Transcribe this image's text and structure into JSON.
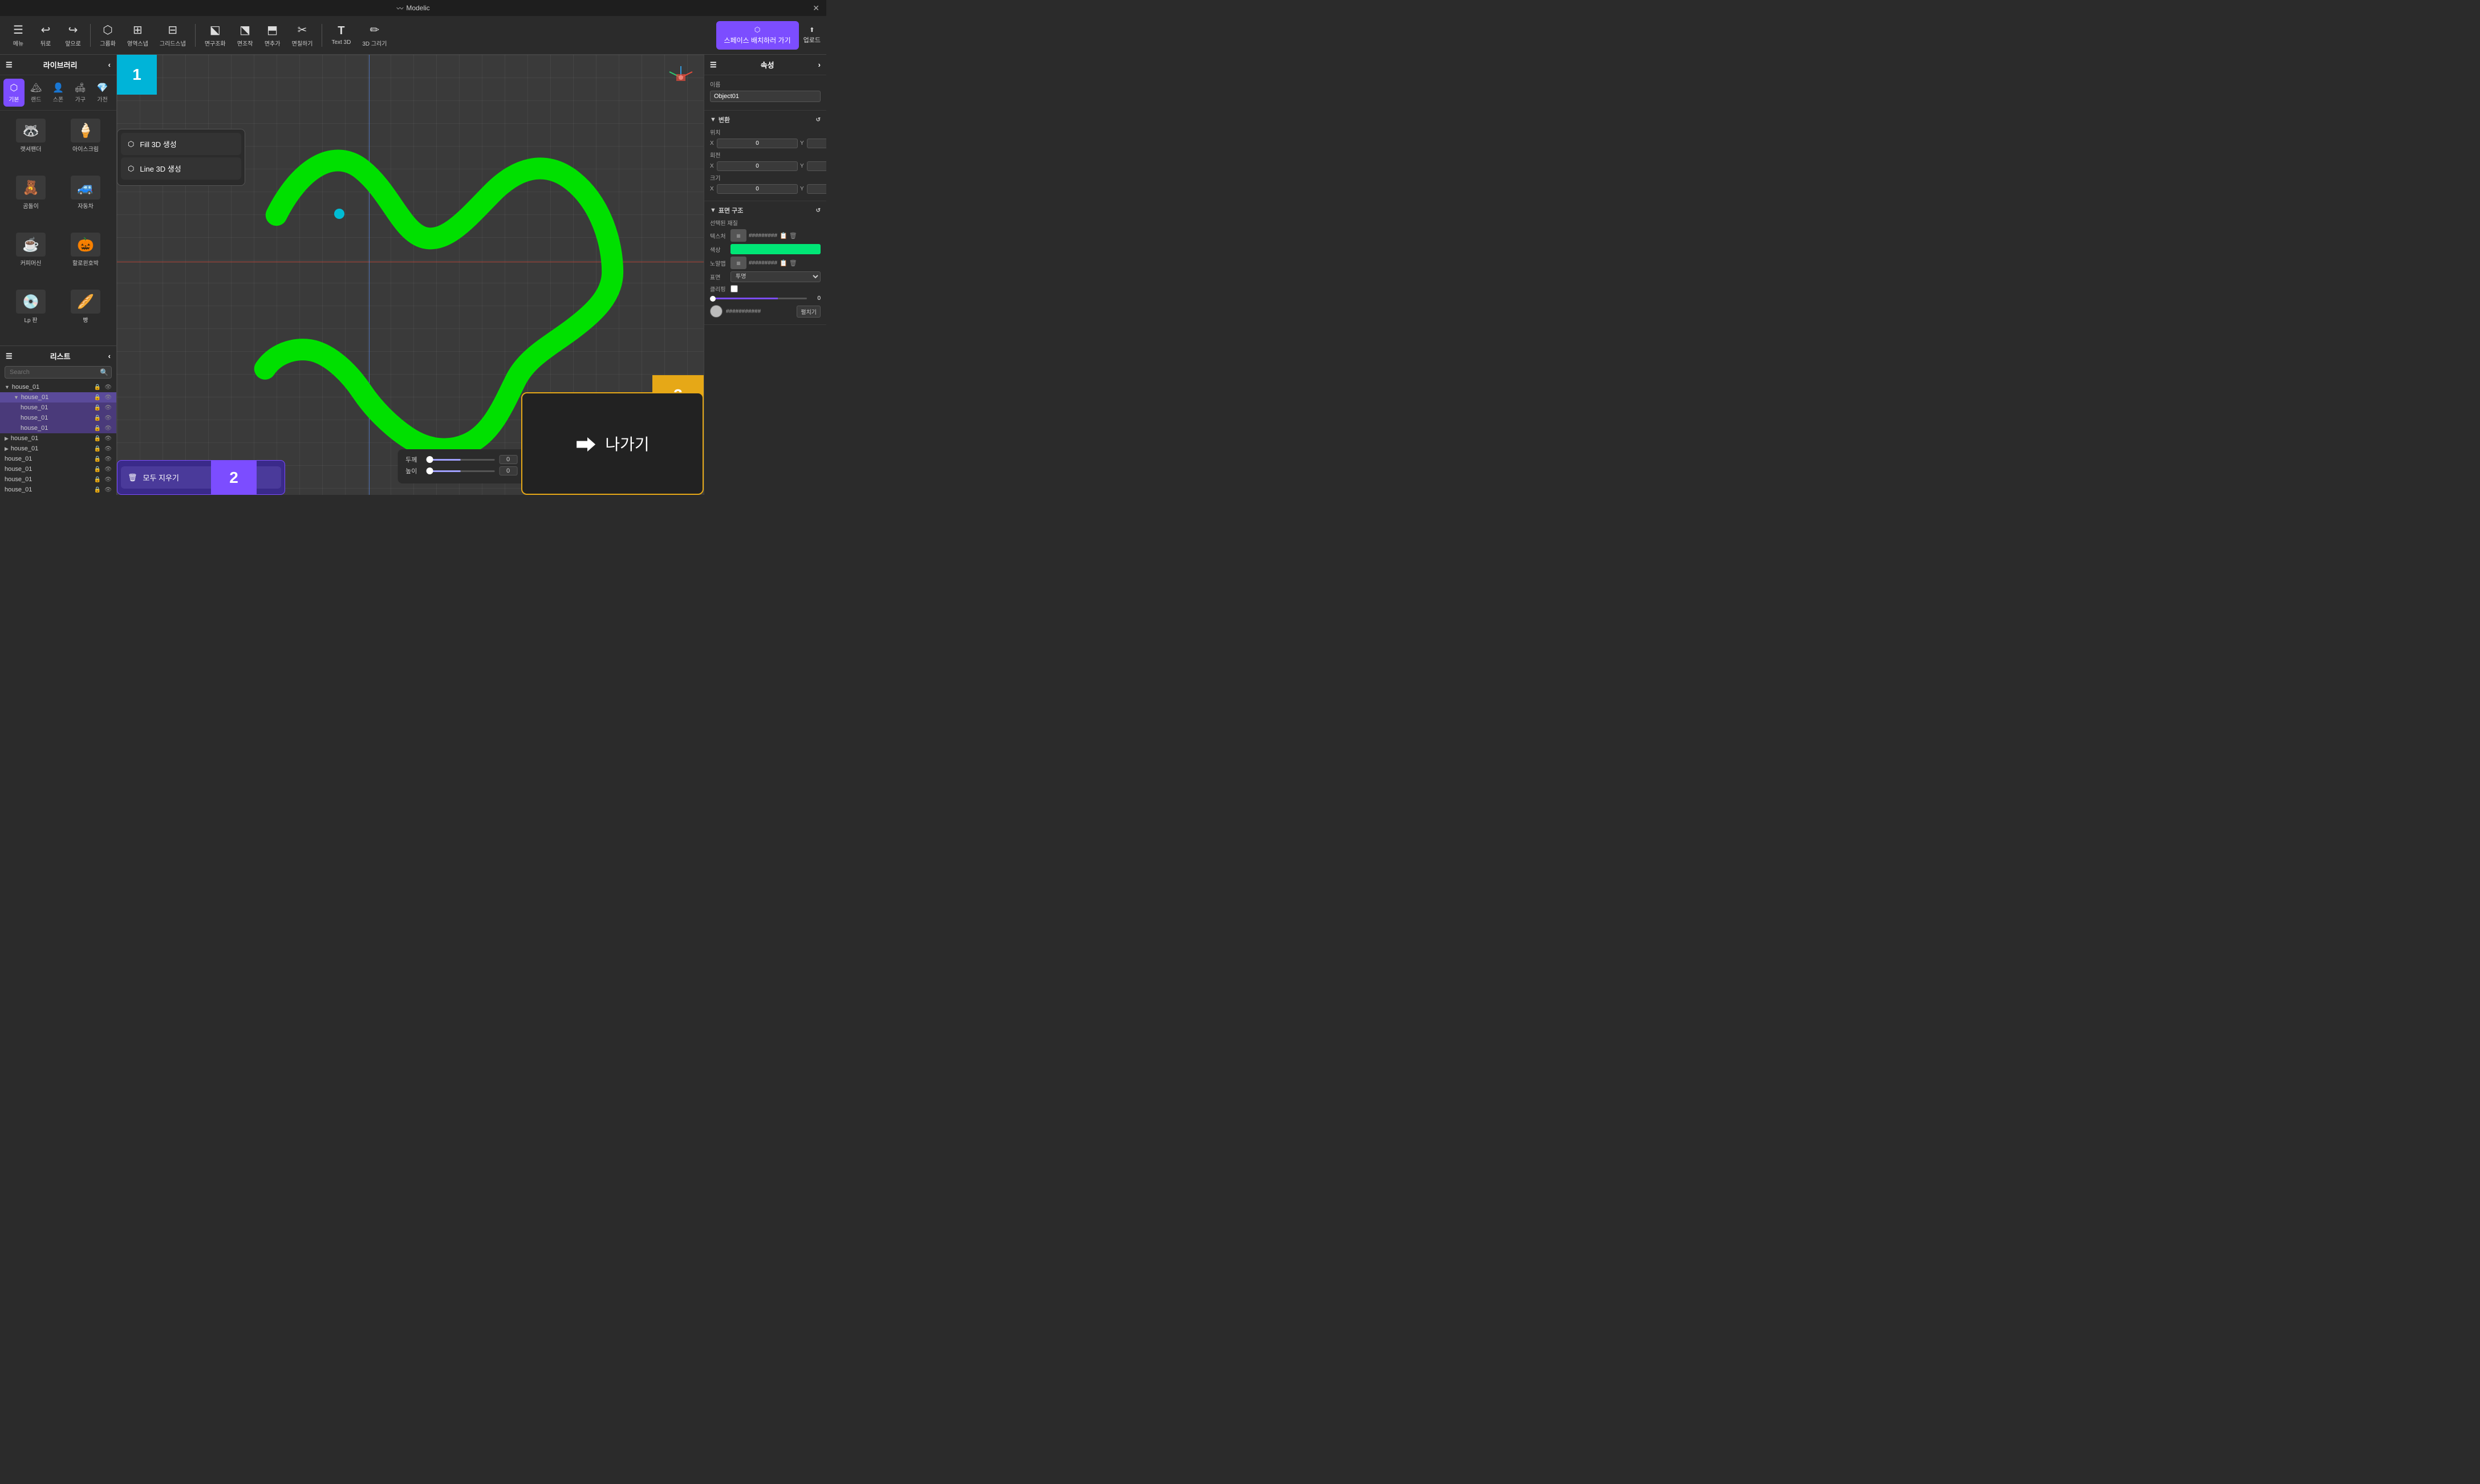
{
  "titleBar": {
    "title": "Modelic",
    "closeLabel": "✕"
  },
  "toolbar": {
    "items": [
      {
        "id": "menu",
        "icon": "☰",
        "label": "메뉴"
      },
      {
        "id": "undo",
        "icon": "↩",
        "label": "뒤로"
      },
      {
        "id": "redo",
        "icon": "↪",
        "label": "앞으로"
      },
      {
        "id": "group",
        "icon": "⬡",
        "label": "그룹화"
      },
      {
        "id": "area-snap",
        "icon": "⊞",
        "label": "영역스냅"
      },
      {
        "id": "grid-snap",
        "icon": "⊟",
        "label": "그리드스냅"
      },
      {
        "id": "face-edit",
        "icon": "⬕",
        "label": "면구조화"
      },
      {
        "id": "vertex-edit",
        "icon": "⬔",
        "label": "면조작"
      },
      {
        "id": "vertex-add",
        "icon": "⬒",
        "label": "면추가"
      },
      {
        "id": "smooth",
        "icon": "✂",
        "label": "면칠하기"
      },
      {
        "id": "text3d",
        "icon": "T",
        "label": "Text 3D"
      },
      {
        "id": "draw3d",
        "icon": "✏",
        "label": "3D 그리기"
      }
    ],
    "spaceButton": "스페이스 배치하러 가기",
    "uploadButton": "업로드"
  },
  "library": {
    "title": "라이브러리",
    "navItems": [
      {
        "id": "basic",
        "icon": "⬡",
        "label": "기본",
        "active": true
      },
      {
        "id": "land",
        "icon": "🏔",
        "label": "랜드"
      },
      {
        "id": "spawn",
        "icon": "👤",
        "label": "스폰"
      },
      {
        "id": "furniture",
        "icon": "🛋",
        "label": "가구"
      },
      {
        "id": "accessory",
        "icon": "💎",
        "label": "가전"
      }
    ],
    "items": [
      {
        "id": "raccoon",
        "emoji": "🦝",
        "label": "랫셔팬더"
      },
      {
        "id": "icecream",
        "emoji": "🍦",
        "label": "아이스크림"
      },
      {
        "id": "bear",
        "emoji": "🧸",
        "label": "곰돌이"
      },
      {
        "id": "car",
        "emoji": "🚙",
        "label": "자동차"
      },
      {
        "id": "coffee",
        "emoji": "☕",
        "label": "커피머신"
      },
      {
        "id": "pumpkin",
        "emoji": "🎃",
        "label": "할로윈호박"
      },
      {
        "id": "lp",
        "emoji": "💿",
        "label": "Lp 판"
      },
      {
        "id": "bread",
        "emoji": "🥖",
        "label": "빵"
      }
    ]
  },
  "list": {
    "title": "리스트",
    "searchPlaceholder": "Search",
    "items": [
      {
        "id": "house01-root",
        "label": "house_01",
        "indent": 0,
        "expanded": true,
        "selected": false
      },
      {
        "id": "house01-child",
        "label": "house_01",
        "indent": 1,
        "expanded": true,
        "selected": true,
        "highlight": true
      },
      {
        "id": "house01-1",
        "label": "house_01",
        "indent": 2,
        "selected": false
      },
      {
        "id": "house01-2",
        "label": "house_01",
        "indent": 2,
        "selected": false
      },
      {
        "id": "house01-3",
        "label": "house_01",
        "indent": 2,
        "selected": false
      },
      {
        "id": "house01-4",
        "label": "house_01",
        "indent": 0,
        "selected": false
      },
      {
        "id": "house01-5",
        "label": "house_01",
        "indent": 0,
        "selected": false
      },
      {
        "id": "house01-6",
        "label": "house_01",
        "indent": 0,
        "selected": false
      },
      {
        "id": "house01-7",
        "label": "house_01",
        "indent": 0,
        "selected": false
      },
      {
        "id": "house01-8",
        "label": "house_01",
        "indent": 0,
        "selected": false
      },
      {
        "id": "house01-9",
        "label": "house_01",
        "indent": 0,
        "selected": false
      }
    ]
  },
  "popupMenu": {
    "fill3d": "Fill 3D 생성",
    "line3d": "Line 3D 생성",
    "clearAll": "모두 지우기"
  },
  "canvasControls": {
    "thicknessLabel": "두께",
    "heightLabel": "높이",
    "thicknessValue": "0",
    "heightValue": "0"
  },
  "exitOverlay": {
    "label": "나가기"
  },
  "badges": {
    "badge1": "1",
    "badge2": "2",
    "badge3": "3"
  },
  "properties": {
    "title": "속성",
    "nameLabel": "이름",
    "nameValue": "Object01",
    "transformTitle": "변환",
    "positionLabel": "위치",
    "rotationLabel": "회전",
    "scaleLabel": "크기",
    "xyzDefault": "0",
    "surfaceTitle": "표면 구조",
    "selectedMaterialLabel": "선택된 재질",
    "textureLabel": "텍스처",
    "textureName": "#########",
    "colorLabel": "색상",
    "normalLabel": "노말맵",
    "normalName": "#########",
    "surfaceLabel": "표면",
    "surfaceValue": "투명",
    "clippingLabel": "클리핑",
    "sliderValue": "0",
    "materialName": "###########",
    "expandLabel": "펼치기"
  }
}
